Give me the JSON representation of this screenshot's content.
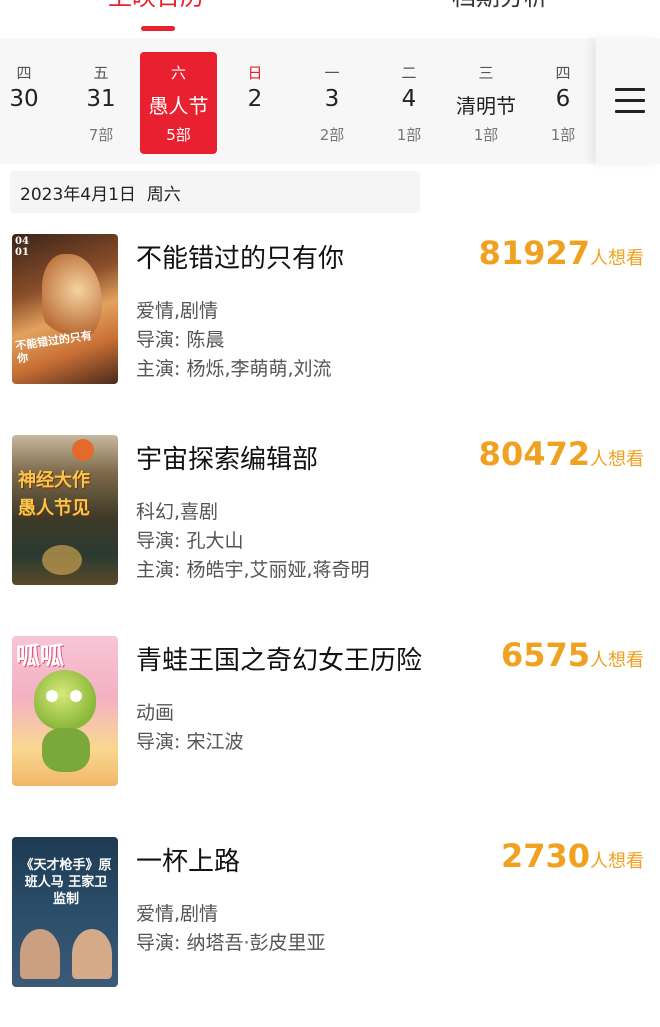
{
  "tabs": {
    "release": "上映日历",
    "analysis": "档期分析"
  },
  "dates": [
    {
      "weekday": "四",
      "date": "30",
      "count": ""
    },
    {
      "weekday": "五",
      "date": "31",
      "count": "7部"
    },
    {
      "weekday": "六",
      "date": "愚人节",
      "count": "5部",
      "selected": true
    },
    {
      "weekday": "日",
      "date": "2",
      "count": ""
    },
    {
      "weekday": "一",
      "date": "3",
      "count": "2部"
    },
    {
      "weekday": "二",
      "date": "4",
      "count": "1部"
    },
    {
      "weekday": "三",
      "date": "清明节",
      "count": "1部"
    },
    {
      "weekday": "四",
      "date": "6",
      "count": "1部"
    }
  ],
  "date_header": "2023年4月1日  周六",
  "movies": [
    {
      "title": "不能错过的只有你",
      "want": "81927",
      "want_label": "人想看",
      "genre": "爱情,剧情",
      "director": "导演: 陈晨",
      "cast": "主演: 杨烁,李萌萌,刘流",
      "poster_text": "不能错过的只有你",
      "poster_date": "04 01"
    },
    {
      "title": "宇宙探索编辑部",
      "want": "80472",
      "want_label": "人想看",
      "genre": "科幻,喜剧",
      "director": "导演: 孔大山",
      "cast": "主演: 杨皓宇,艾丽娅,蒋奇明",
      "poster_text": "神经大作 愚人节见"
    },
    {
      "title": "青蛙王国之奇幻女王历险",
      "want": "6575",
      "want_label": "人想看",
      "genre": "动画",
      "director": "导演: 宋江波",
      "poster_text": "呱呱"
    },
    {
      "title": "一杯上路",
      "want": "2730",
      "want_label": "人想看",
      "genre": "爱情,剧情",
      "director": "导演: 纳塔吾·彭皮里亚",
      "poster_text": "《天才枪手》原班人马 王家卫监制"
    }
  ],
  "colors": {
    "accent": "#e8202f",
    "want": "#f0a11f"
  }
}
